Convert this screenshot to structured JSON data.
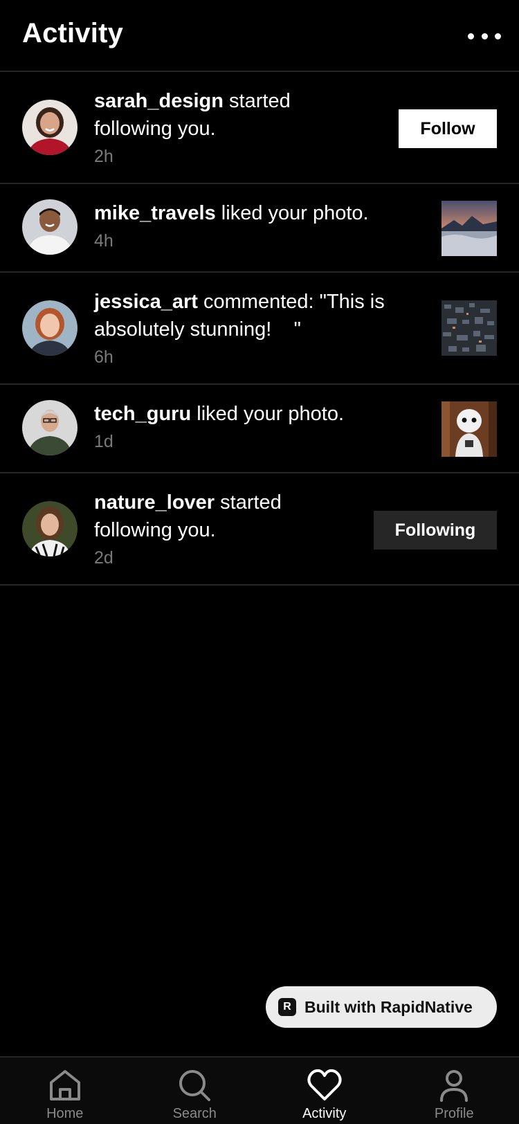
{
  "header": {
    "title": "Activity",
    "more_icon": "more-horizontal-icon"
  },
  "activities": [
    {
      "username": "sarah_design",
      "action": " started following you.",
      "time": "2h",
      "action_button": "Follow"
    },
    {
      "username": "mike_travels",
      "action": " liked your photo.",
      "time": "4h",
      "thumbnail": "mountain-sunset-photo"
    },
    {
      "username": "jessica_art",
      "action": " commented: \"This is absolutely stunning!    \"",
      "time": "6h",
      "thumbnail": "city-aerial-photo"
    },
    {
      "username": "tech_guru",
      "action": " liked your photo.",
      "time": "1d",
      "thumbnail": "robot-photo"
    },
    {
      "username": "nature_lover",
      "action": " started following you.",
      "time": "2d",
      "action_button": "Following"
    }
  ],
  "badge": {
    "text": "Built with RapidNative",
    "icon": "R"
  },
  "tabs": [
    {
      "label": "Home",
      "icon": "home-icon",
      "active": false
    },
    {
      "label": "Search",
      "icon": "search-icon",
      "active": false
    },
    {
      "label": "Activity",
      "icon": "heart-icon",
      "active": true
    },
    {
      "label": "Profile",
      "icon": "profile-icon",
      "active": false
    }
  ],
  "colors": {
    "background": "#000000",
    "divider": "#262626",
    "muted_text": "#7a7a7a",
    "following_button": "#262626"
  }
}
